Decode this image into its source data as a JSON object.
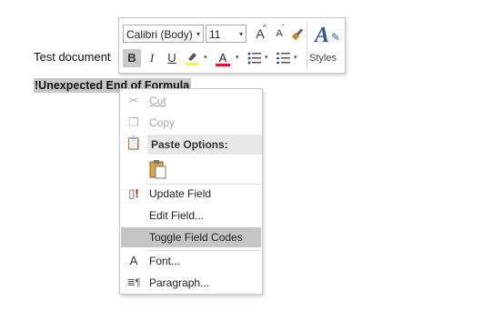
{
  "document": {
    "line1": "Test document",
    "line2": "!Unexpected End of Formula"
  },
  "mini_toolbar": {
    "font_name": "Calibri (Body)",
    "font_size": "11",
    "bold": "B",
    "italic": "I",
    "underline": "U",
    "font_color_letter": "A",
    "grow_font": "A",
    "shrink_font": "A",
    "styles_label": "Styles",
    "highlight_color": "#ffff00",
    "font_color": "#e81123"
  },
  "context_menu": {
    "items": [
      {
        "label": "Cut",
        "icon": "scissors-icon",
        "enabled": false
      },
      {
        "label": "Copy",
        "icon": "copy-icon",
        "enabled": false
      },
      {
        "label": "Paste Options:",
        "icon": "clipboard-icon",
        "header": true
      },
      {
        "label": "Update Field",
        "icon": "update-field-icon",
        "enabled": true
      },
      {
        "label": "Edit Field...",
        "icon": "",
        "enabled": true
      },
      {
        "label": "Toggle Field Codes",
        "icon": "",
        "enabled": true,
        "highlighted": true
      },
      {
        "label": "Font...",
        "icon": "font-icon",
        "enabled": true
      },
      {
        "label": "Paragraph...",
        "icon": "paragraph-icon",
        "enabled": true
      }
    ]
  }
}
